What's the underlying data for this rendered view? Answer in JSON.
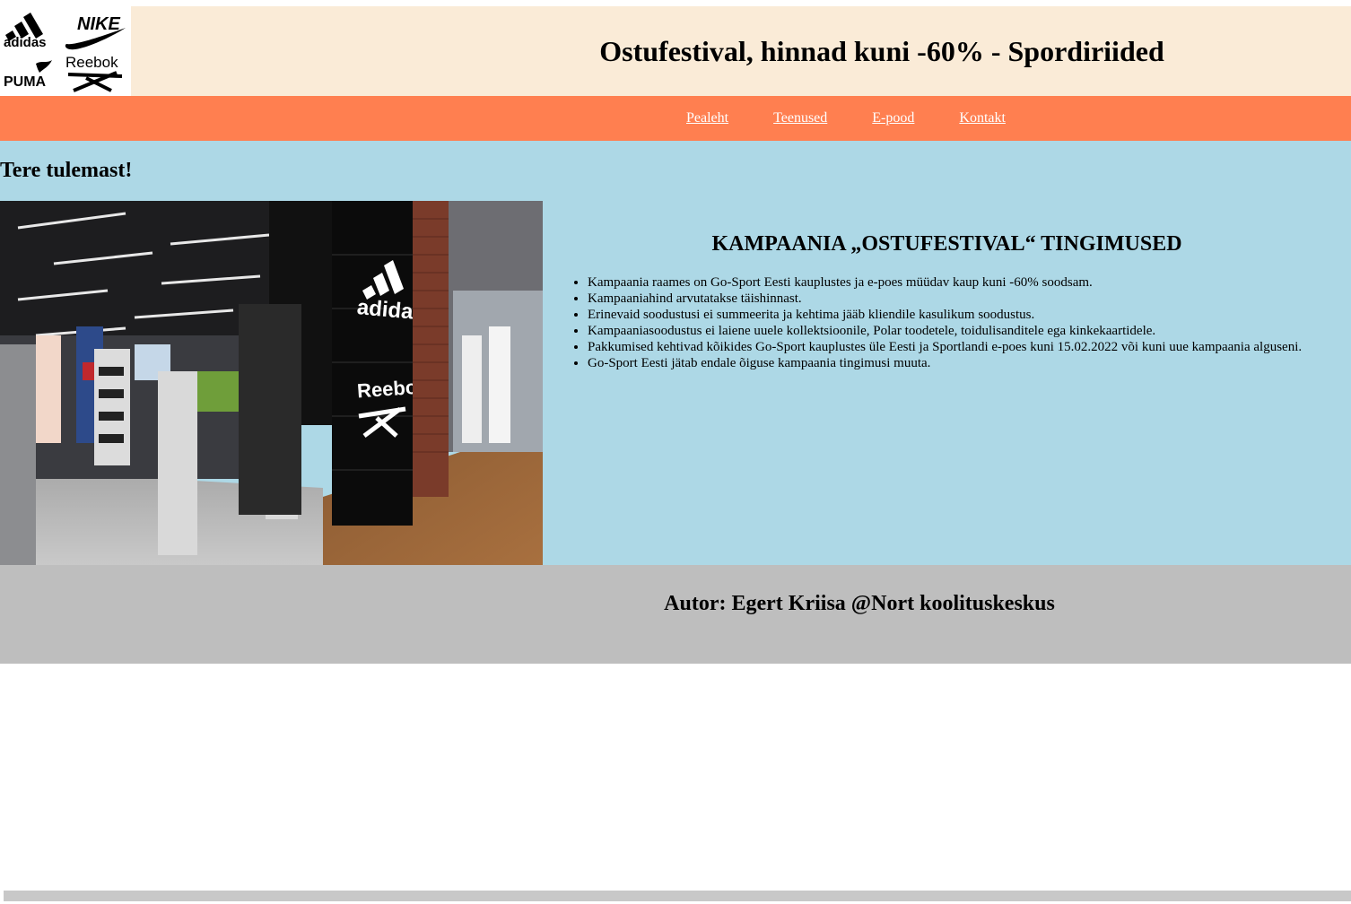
{
  "header": {
    "title": "Ostufestival, hinnad kuni -60% - Spordiriided",
    "logo": {
      "brands": [
        "adidas",
        "NIKE",
        "PUMA",
        "Reebok"
      ]
    }
  },
  "nav": {
    "items": [
      {
        "label": "Pealeht"
      },
      {
        "label": "Teenused"
      },
      {
        "label": "E-pood"
      },
      {
        "label": "Kontakt"
      }
    ]
  },
  "main": {
    "welcome": "Tere tulemast!",
    "photo": {
      "signs": [
        "adidas",
        "Reebok"
      ]
    },
    "terms": {
      "title": "KAMPAANIA „OSTUFESTIVAL“ TINGIMUSED",
      "items": [
        "Kampaania raames on Go-Sport Eesti kauplustes ja e-poes müüdav kaup kuni -60% soodsam.",
        "Kampaaniahind arvutatakse täishinnast.",
        "Erinevaid soodustusi ei summeerita ja kehtima jääb kliendile kasulikum soodustus.",
        "Kampaaniasoodustus ei laiene uuele kollektsioonile, Polar toodetele, toidulisanditele ega kinkekaartidele.",
        "Pakkumised kehtivad kõikides Go-Sport kauplustes üle Eesti ja Sportlandi e-poes kuni 15.02.2022 või kuni uue kampaania alguseni.",
        "Go-Sport Eesti jätab endale õiguse kampaania tingimusi muuta."
      ]
    }
  },
  "footer": {
    "text": "Autor: Egert Kriisa @Nort koolituskeskus"
  },
  "colors": {
    "header_bg": "#FAEBD7",
    "nav_bg": "#FF7F50",
    "main_bg": "#ADD8E6",
    "footer_bg": "#BEBEBE"
  }
}
